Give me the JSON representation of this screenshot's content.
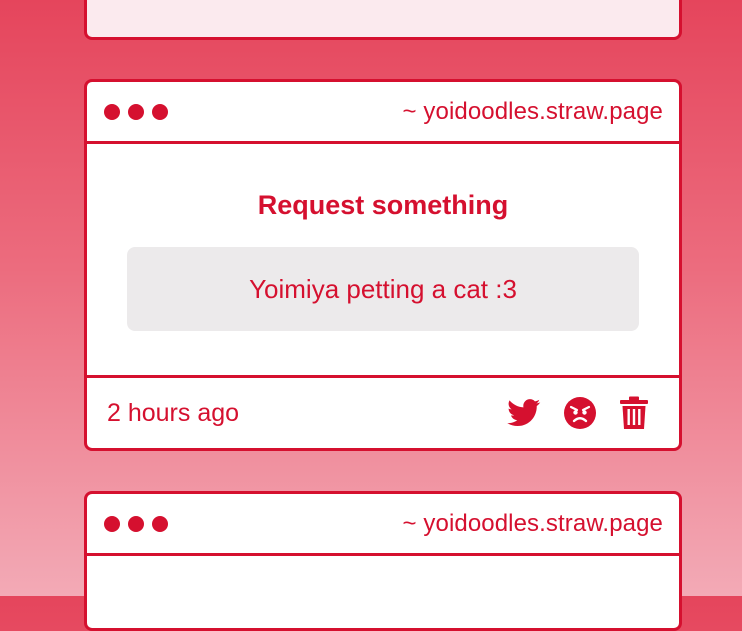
{
  "theme": {
    "accent": "#d5102f",
    "card_bg": "#ffffff",
    "request_bg": "#eceaeb",
    "page_gradient": [
      "#e5455c",
      "#f3aab6"
    ]
  },
  "cards": [
    {
      "site": "~ yoidoodles.straw.page",
      "title": "Request something",
      "request_text": "Yoimiya petting a cat :3",
      "timestamp": "2 hours ago",
      "actions": [
        "twitter-icon",
        "angry-face-icon",
        "trash-icon"
      ]
    },
    {
      "site": "~ yoidoodles.straw.page"
    }
  ]
}
